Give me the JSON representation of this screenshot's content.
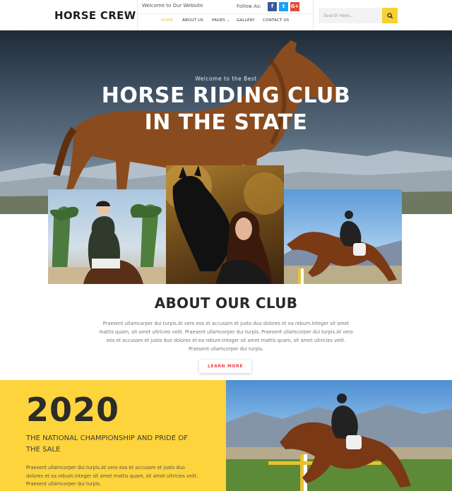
{
  "header": {
    "logo": "HORSE CREW",
    "welcome": "Welcome to Our Website",
    "follow_label": "Follow As:",
    "social": [
      {
        "name": "facebook",
        "glyph": "f",
        "color": "#3b5998"
      },
      {
        "name": "twitter",
        "glyph": "t",
        "color": "#1da1f2"
      },
      {
        "name": "google-plus",
        "glyph": "G+",
        "color": "#dd4b39"
      }
    ],
    "nav": [
      {
        "label": "HOME",
        "active": true
      },
      {
        "label": "ABOUT US",
        "active": false
      },
      {
        "label": "PAGES",
        "active": false,
        "dropdown": true
      },
      {
        "label": "GALLERY",
        "active": false
      },
      {
        "label": "CONTACT US",
        "active": false
      }
    ],
    "search_placeholder": "Search Here...",
    "accent": "#f2c31a"
  },
  "hero": {
    "subtitle": "Welcome to the Best",
    "title_line1": "HORSE RIDING CLUB",
    "title_line2": "IN THE STATE"
  },
  "about": {
    "title": "ABOUT OUR CLUB",
    "text": "Praesent ullamcorper dui turpis.At vero eos et accusam et justo duo dolores et ea rebum.Integer sit amet mattis quam, sit amet ultricies velit. Praesent ullamcorper dui turpis. Praesent ullamcorper dui turpis.At vero eos et accusam et justo duo dolores et ea rebum.Integer sit amet mattis quam, sit amet ultricies velit. Praesent ullamcorper dui turpis.",
    "button": "LEARN MORE"
  },
  "champion": {
    "year": "2020",
    "heading": "THE NATIONAL CHAMPIONSHIP AND PRIDE OF THE SALE",
    "text": "Praesent ullamcorper dui turpis.At vero eos et accusam et justo duo dolores et ea rebum.Integer sit amet mattis quam, sit amet ultricies velit. Praesent ullamcorper dui turpis.",
    "bg_color": "#fdd43b"
  }
}
